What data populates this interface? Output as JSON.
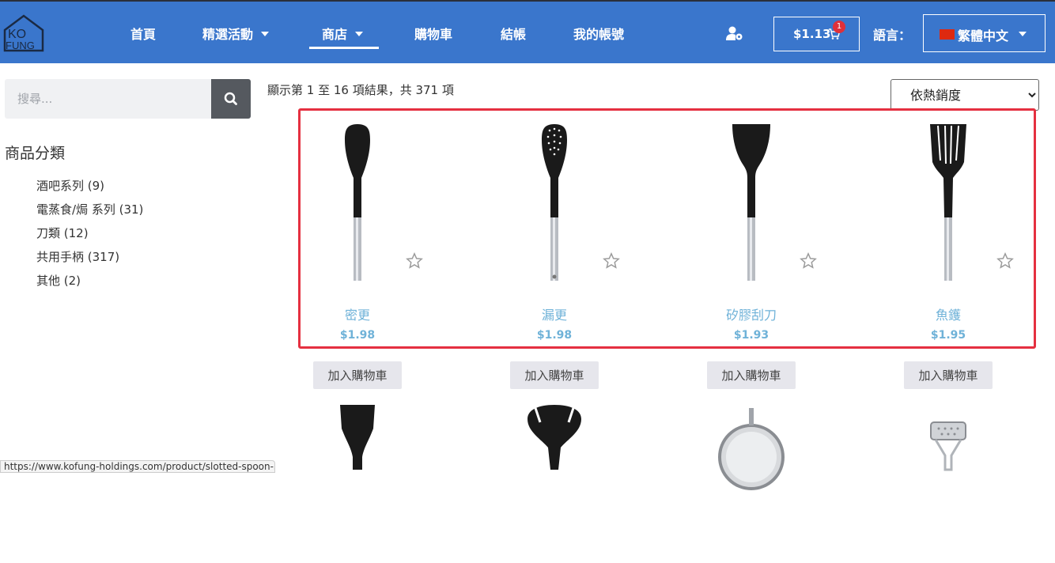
{
  "header": {
    "logo_text_top": "KO",
    "logo_text_bottom": "FUNG",
    "nav": [
      {
        "label": "首頁",
        "has_dropdown": false
      },
      {
        "label": "精選活動",
        "has_dropdown": true
      },
      {
        "label": "商店",
        "has_dropdown": true,
        "active": true
      },
      {
        "label": "購物車",
        "has_dropdown": false
      },
      {
        "label": "結帳",
        "has_dropdown": false
      },
      {
        "label": "我的帳號",
        "has_dropdown": false
      }
    ],
    "cart_amount": "$1.13",
    "cart_count": "1",
    "lang_label": "語言：",
    "lang_value": "繁體中文"
  },
  "sidebar": {
    "search_placeholder": "搜尋...",
    "categories_title": "商品分類",
    "categories": [
      "酒吧系列 (9)",
      "電蒸食/焗 系列 (31)",
      "刀類 (12)",
      "共用手柄 (317)",
      "其他 (2)"
    ]
  },
  "main": {
    "result_count": "顯示第 1 至 16 項結果，共 371 項",
    "sort_selected": "依熱銷度",
    "products": [
      {
        "name": "密更",
        "price": "$1.98",
        "type": "solid-spoon"
      },
      {
        "name": "漏更",
        "price": "$1.98",
        "type": "slotted-spoon"
      },
      {
        "name": "矽膠刮刀",
        "price": "$1.93",
        "type": "spatula"
      },
      {
        "name": "魚鑊",
        "price": "$1.95",
        "type": "fish-turner"
      }
    ],
    "add_to_cart_label": "加入購物車"
  },
  "status_bar": {
    "url": "https://www.kofung-holdings.com/product/slotted-spoon-3/"
  },
  "colors": {
    "header_bg": "#3a76cc",
    "accent_link": "#6fb2d8",
    "highlight_border": "#e53040"
  }
}
